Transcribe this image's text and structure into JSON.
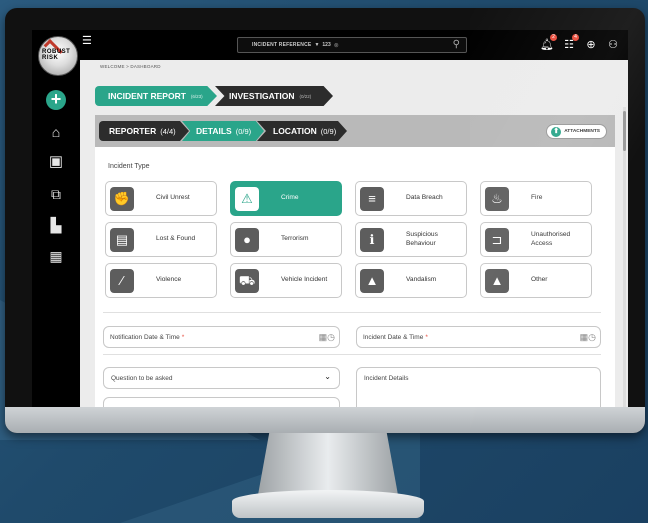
{
  "logo": {
    "text": "ROBUST RISK"
  },
  "topbar": {
    "search_ref_label": "INCIDENT REFERENCE",
    "search_ref_value": "123",
    "notifications_count": "2",
    "tasks_count": "4"
  },
  "breadcrumb": "WELCOME > DASHBOARD",
  "stages": [
    {
      "label": "INCIDENT REPORT",
      "count": "(6/23)"
    },
    {
      "label": "INVESTIGATION",
      "count": "(0/22)"
    }
  ],
  "substeps": [
    {
      "label": "REPORTER",
      "count": "(4/4)"
    },
    {
      "label": "DETAILS",
      "count": "(0/9)"
    },
    {
      "label": "LOCATION",
      "count": "(0/9)"
    }
  ],
  "attachments_label": "ATTACHMENTS",
  "incident_type_heading": "Incident Type",
  "incident_types": [
    {
      "label": "Civil Unrest",
      "icon": "civil-unrest-icon",
      "selected": false
    },
    {
      "label": "Crime",
      "icon": "siren-icon",
      "selected": true
    },
    {
      "label": "Data Breach",
      "icon": "database-icon",
      "selected": false
    },
    {
      "label": "Fire",
      "icon": "fire-icon",
      "selected": false
    },
    {
      "label": "Lost & Found",
      "icon": "box-icon",
      "selected": false
    },
    {
      "label": "Terrorism",
      "icon": "bomb-icon",
      "selected": false
    },
    {
      "label": "Suspicious Behaviour",
      "icon": "suspicious-person-icon",
      "selected": false
    },
    {
      "label": "Unauthorised Access",
      "icon": "door-icon",
      "selected": false
    },
    {
      "label": "Violence",
      "icon": "knife-icon",
      "selected": false
    },
    {
      "label": "Vehicle Incident",
      "icon": "vehicle-icon",
      "selected": false
    },
    {
      "label": "Vandalism",
      "icon": "vandalism-icon",
      "selected": false
    },
    {
      "label": "Other",
      "icon": "warning-icon",
      "selected": false
    }
  ],
  "fields": {
    "notification_datetime": "Notification Date & Time",
    "incident_datetime": "Incident Date & Time",
    "question_select": "Question to be asked",
    "incident_details": "Incident Details",
    "required_mark": "*"
  },
  "colors": {
    "accent": "#2aa58a",
    "dark": "#2c2c2c",
    "badge": "#e74c3c"
  }
}
